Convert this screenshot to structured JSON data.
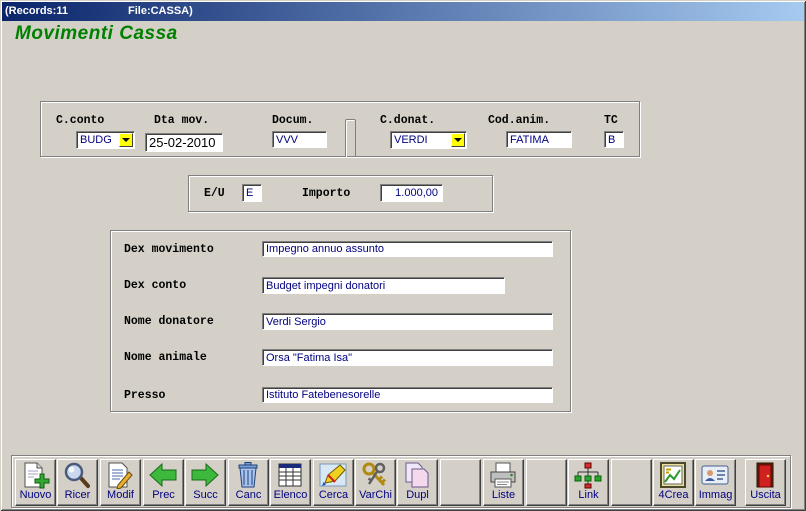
{
  "window": {
    "records": "(Records:11",
    "file": "File:CASSA)"
  },
  "form": {
    "title": "Movimenti Cassa"
  },
  "header_group": {
    "c_conto": {
      "label": "C.conto",
      "value": "BUDG"
    },
    "dta_mov": {
      "label": "Dta mov.",
      "value": "25-02-2010"
    },
    "docum": {
      "label": "Docum.",
      "value": "VVV"
    },
    "c_donat": {
      "label": "C.donat.",
      "value": "VERDI"
    },
    "cod_anim": {
      "label": "Cod.anim.",
      "value": "FATIMA"
    },
    "tc": {
      "label": "TC",
      "value": "B"
    }
  },
  "amount_group": {
    "eu": {
      "label": "E/U",
      "value": "E"
    },
    "importo": {
      "label": "Importo",
      "value": "1.000,00"
    }
  },
  "details_group": {
    "dex_movimento": {
      "label": "Dex movimento",
      "value": "Impegno annuo assunto"
    },
    "dex_conto": {
      "label": "Dex conto",
      "value": "Budget impegni donatori"
    },
    "nome_donatore": {
      "label": "Nome donatore",
      "value": "Verdi Sergio"
    },
    "nome_animale": {
      "label": "Nome animale",
      "value": "Orsa \"Fatima Isa\""
    },
    "presso": {
      "label": "Presso",
      "value": "Istituto Fatebenesorelle"
    }
  },
  "toolbar": {
    "buttons": [
      {
        "label": "Nuovo",
        "icon": "new-document-icon"
      },
      {
        "label": "Ricer",
        "icon": "magnifier-icon"
      },
      {
        "label": "Modif",
        "icon": "edit-document-icon"
      },
      {
        "label": "Prec",
        "icon": "arrow-left-icon"
      },
      {
        "label": "Succ",
        "icon": "arrow-right-icon"
      },
      {
        "label": "Canc",
        "icon": "trash-can-icon"
      },
      {
        "label": "Elenco",
        "icon": "table-icon"
      },
      {
        "label": "Cerca",
        "icon": "highlighter-icon"
      },
      {
        "label": "VarChi",
        "icon": "keys-icon"
      },
      {
        "label": "Dupl",
        "icon": "duplicate-documents-icon"
      },
      {
        "label": "Liste",
        "icon": "printer-icon"
      },
      {
        "label": "Link",
        "icon": "hierarchy-link-icon"
      },
      {
        "label": "4Crea",
        "icon": "framed-chart-icon"
      },
      {
        "label": "Immag",
        "icon": "id-card-icon"
      },
      {
        "label": "Uscita",
        "icon": "exit-door-icon"
      }
    ]
  },
  "colors": {
    "window_background": "#d4d0c8",
    "titlebar_gradient_start": "#0a246a",
    "titlebar_gradient_end": "#a6caf0",
    "form_title": "#008000",
    "field_text": "#000080",
    "combo_button": "#ffff00",
    "toolbar_label": "#000080"
  }
}
